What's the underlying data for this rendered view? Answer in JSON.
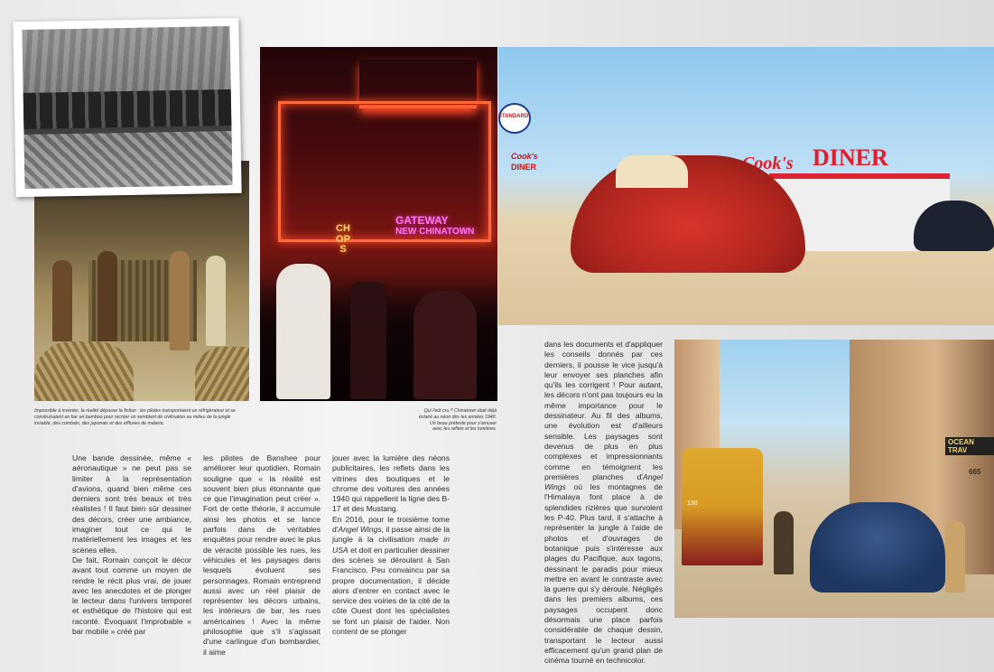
{
  "images": {
    "bar_scene": {
      "icon": "bar-scene-illustration"
    },
    "bw_photo": {
      "icon": "bw-photo-bar-interior"
    },
    "chinatown": {
      "neon_gateway": "GATEWAY",
      "neon_new_chinatown": "NEW CHINATOWN",
      "neon_chops": "CHOPS"
    },
    "diner": {
      "sign_cooks": "Cook's",
      "sign_diner": "DINER",
      "sign_standard": "STANDARD",
      "sign_cooks_small": "Cook's",
      "sign_diner_small": "DINER"
    },
    "street": {
      "sign_ocean": "OCEAN TRAV",
      "building_number": "665",
      "tram_number": "130"
    }
  },
  "captions": {
    "left": "Impossible à inventer, la réalité dépasse la fiction : les pilotes transportaient un réfrigérateur et se construisaient un bar en bambou pour recréer un semblant de civilisation au milieu de la jungle inviable, des combats, des japonais et des effluves de malaria.",
    "right_1": "Qui l'eût cru ? Chinatown était déjà",
    "right_2": "éclairé au néon dès les années 1940.",
    "right_3": "Un beau prétexte pour s'amuser",
    "right_4": "avec les reflets et les lumières."
  },
  "columns": {
    "c1": "Une bande dessinée, même « aéronautique » ne peut pas se limiter à la représentation d'avions, quand bien même ces derniers sont très beaux et très réalistes ! Il faut bien sûr dessiner des décors, créer une ambiance, imaginer tout ce qui le matériellement les images et les scènes elles.",
    "c1b": "De fait, Romain conçoit le décor avant tout comme un moyen de rendre le récit plus vrai, de jouer avec les anecdotes et de plonger le lecteur dans l'univers temporel et esthétique de l'histoire qui est raconté. Évoquant l'improbable « bar mobile » créé par",
    "c2": "les pilotes de Banshee pour améliorer leur quotidien, Romain souligne que « la réalité est souvent bien plus étonnante que ce que l'imagination peut créer ». Fort de cette théorie, il accumule ainsi les photos et se lance parfois dans de véritables enquêtes pour rendre avec le plus de véracité possible les rues, les véhicules et les paysages dans lesquels évoluent ses personnages. Romain entreprend aussi avec un réel plaisir de représenter les décors urbains, les intérieurs de bar, les rues américaines ! Avec la même philosophie que s'il s'agissait d'une carlingue d'un bombardier, il aime",
    "c3": "jouer avec la lumière des néons publicitaires, les reflets dans les vitrines des boutiques et le chrome des voitures des années 1940 qui rappellent la ligne des B-17 et des Mustang.",
    "c3b_pre": "En 2016, pour le troisième tome d'",
    "c3b_title": "Angel Wings",
    "c3b_mid": ", il passe ainsi de la jungle à la civilisation ",
    "c3b_title2": "made in USA",
    "c3b_post": " et doit en particulier dessiner des scènes se déroulant à San Francisco. Peu convaincu par sa propre documentation, il décide alors d'entrer en contact avec le service des voiries de la cité de la côte Ouest dont les spécialistes se font un plaisir de l'aider. Non content de se plonger",
    "c4_pre": "dans les documents et d'appliquer les conseils donnés par ces derniers, il pousse le vice jusqu'à leur envoyer ses planches afin qu'ils les corrigent ! Pour autant, les décors n'ont pas toujours eu la même importance pour le dessinateur. Au fil des albums, une évolution est d'ailleurs sensible. Les paysages sont devenus de plus en plus complexes et impressionnants comme en témoignent les premières planches d'",
    "c4_title": "Angel Wings",
    "c4_post": " où les montagnes de l'Himalaya font place à de splendides rizières que survolent les P-40. Plus tard, il s'attache à représenter la jungle à l'aide de photos et d'ouvrages de botanique puis s'intéresse aux plages du Pacifique, aux lagons, dessinant le paradis pour mieux mettre en avant le contraste avec la guerre qui s'y déroule. Négligés dans les premiers albums, ces paysages occupent donc désormais une place parfois considérable de chaque dessin, transportant le lecteur aussi efficacement qu'un grand plan de cinéma tourné en technicolor."
  }
}
